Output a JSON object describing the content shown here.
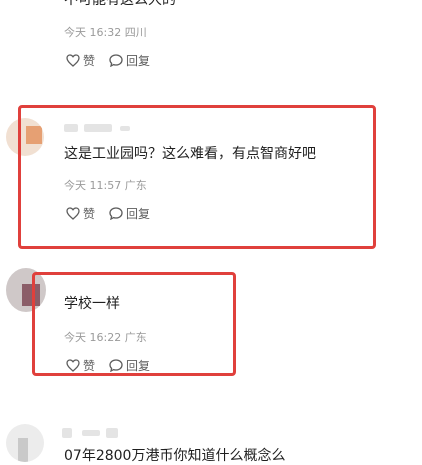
{
  "comments": [
    {
      "text": "不可能有这么大的",
      "time": "今天 16:32",
      "region": "四川",
      "like_label": "赞",
      "reply_label": "回复"
    },
    {
      "text": "这是工业园吗？这么难看，有点智商好吧",
      "time": "今天 11:57",
      "region": "广东",
      "like_label": "赞",
      "reply_label": "回复"
    },
    {
      "text": "学校一样",
      "time": "今天 16:22",
      "region": "广东",
      "like_label": "赞",
      "reply_label": "回复"
    },
    {
      "text": "07年2800万港币你知道什么概念么"
    }
  ],
  "colors": {
    "highlight": "#e0403c",
    "meta": "#9a9a9a",
    "text": "#1f1f1f"
  }
}
